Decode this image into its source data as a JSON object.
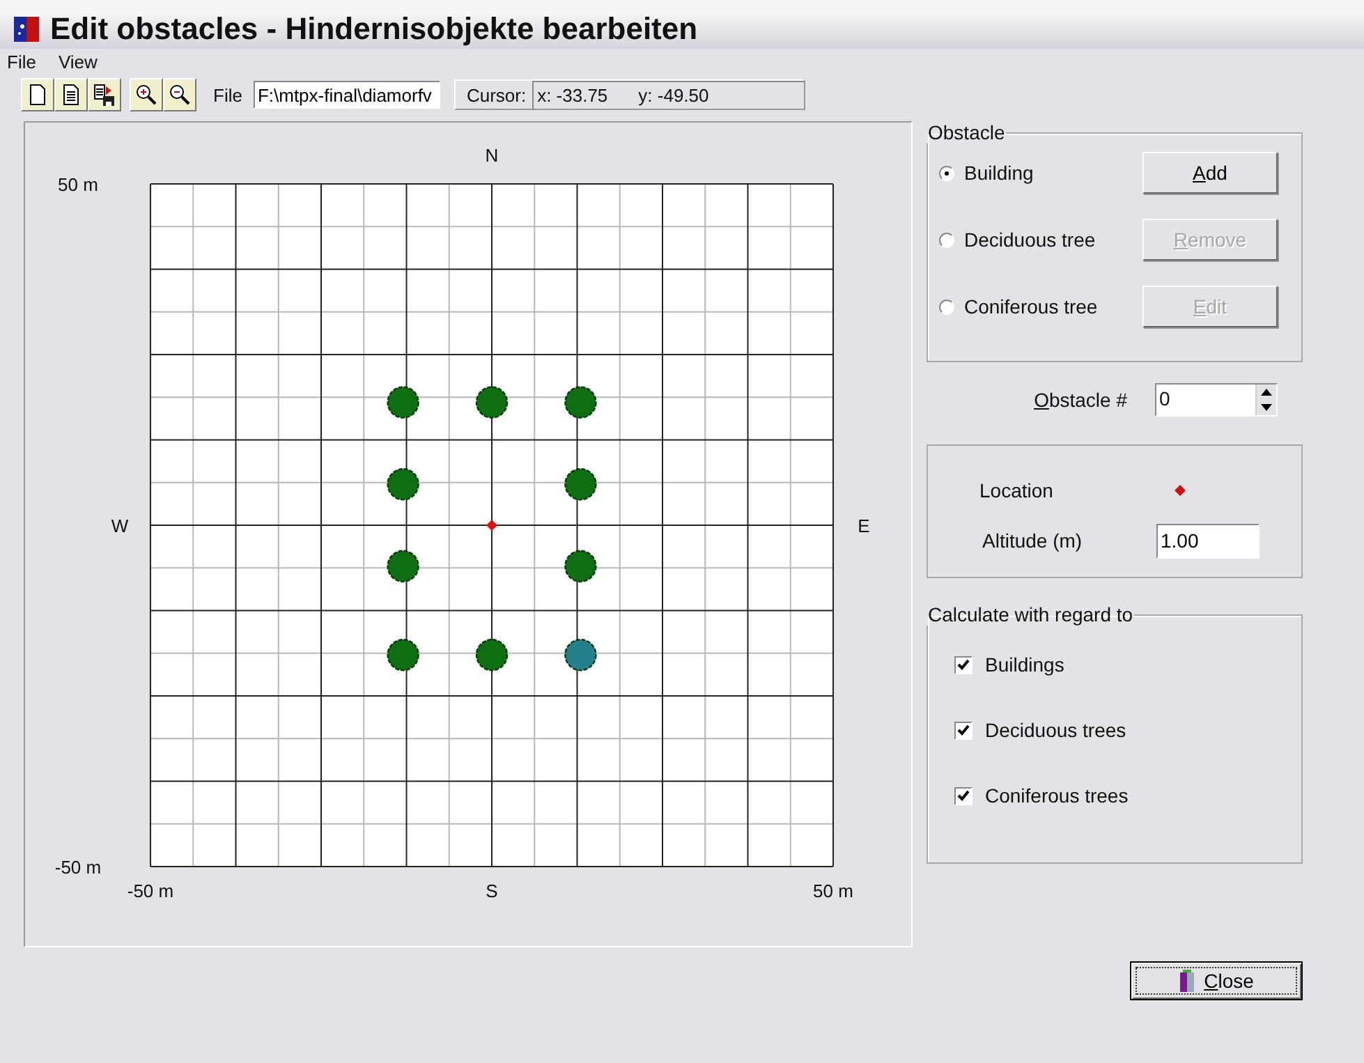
{
  "window": {
    "title": "Edit obstacles - Hindernisobjekte bearbeiten"
  },
  "menu": [
    "File",
    "View"
  ],
  "toolbar": {
    "file_label": "File",
    "file_path": "F:\\mtpx-final\\diamorfv",
    "cursor_label": "Cursor:",
    "cursor_x": "x: -33.75",
    "cursor_y": "y: -49.50"
  },
  "plot": {
    "compass": {
      "north": "N",
      "south": "S",
      "west": "W",
      "east": "E"
    },
    "chart_data": {
      "type": "scatter",
      "xlim": [
        -50,
        50
      ],
      "ylim": [
        -50,
        50
      ],
      "xticks": [
        {
          "value": -50,
          "label": "-50 m"
        },
        {
          "value": 50,
          "label": "50 m"
        }
      ],
      "yticks": [
        {
          "value": -50,
          "label": "-50 m"
        },
        {
          "value": 50,
          "label": "50 m"
        }
      ],
      "series": [
        {
          "color": "#0e6e12",
          "x": [
            -13,
            0,
            13,
            -13,
            13,
            -13,
            13,
            -13,
            0
          ],
          "values": [
            18,
            18,
            18,
            6,
            6,
            -6,
            -6,
            -19,
            -19
          ]
        },
        {
          "color": "#24808c",
          "x": [
            13
          ],
          "values": [
            -19
          ]
        },
        {
          "color": "#e01010",
          "x": [
            0
          ],
          "values": [
            0
          ]
        }
      ]
    }
  },
  "obstacle": {
    "title": "Obstacle",
    "types": [
      {
        "label": "Building",
        "selected": true
      },
      {
        "label": "Deciduous tree",
        "selected": false
      },
      {
        "label": "Coniferous tree",
        "selected": false
      }
    ],
    "buttons": [
      {
        "label": "Add",
        "disabled": false
      },
      {
        "label": "Remove",
        "disabled": true
      },
      {
        "label": "Edit",
        "disabled": true
      }
    ]
  },
  "obstacle_number": {
    "label": "Obstacle #",
    "value": "0"
  },
  "location": {
    "label": "Location",
    "altitude_label": "Altitude (m)",
    "altitude": "1.00"
  },
  "calculate": {
    "title": "Calculate with regard to",
    "items": [
      {
        "label": "Buildings",
        "checked": true
      },
      {
        "label": "Deciduous trees",
        "checked": true
      },
      {
        "label": "Coniferous trees",
        "checked": true
      }
    ]
  },
  "close_button": "Close"
}
